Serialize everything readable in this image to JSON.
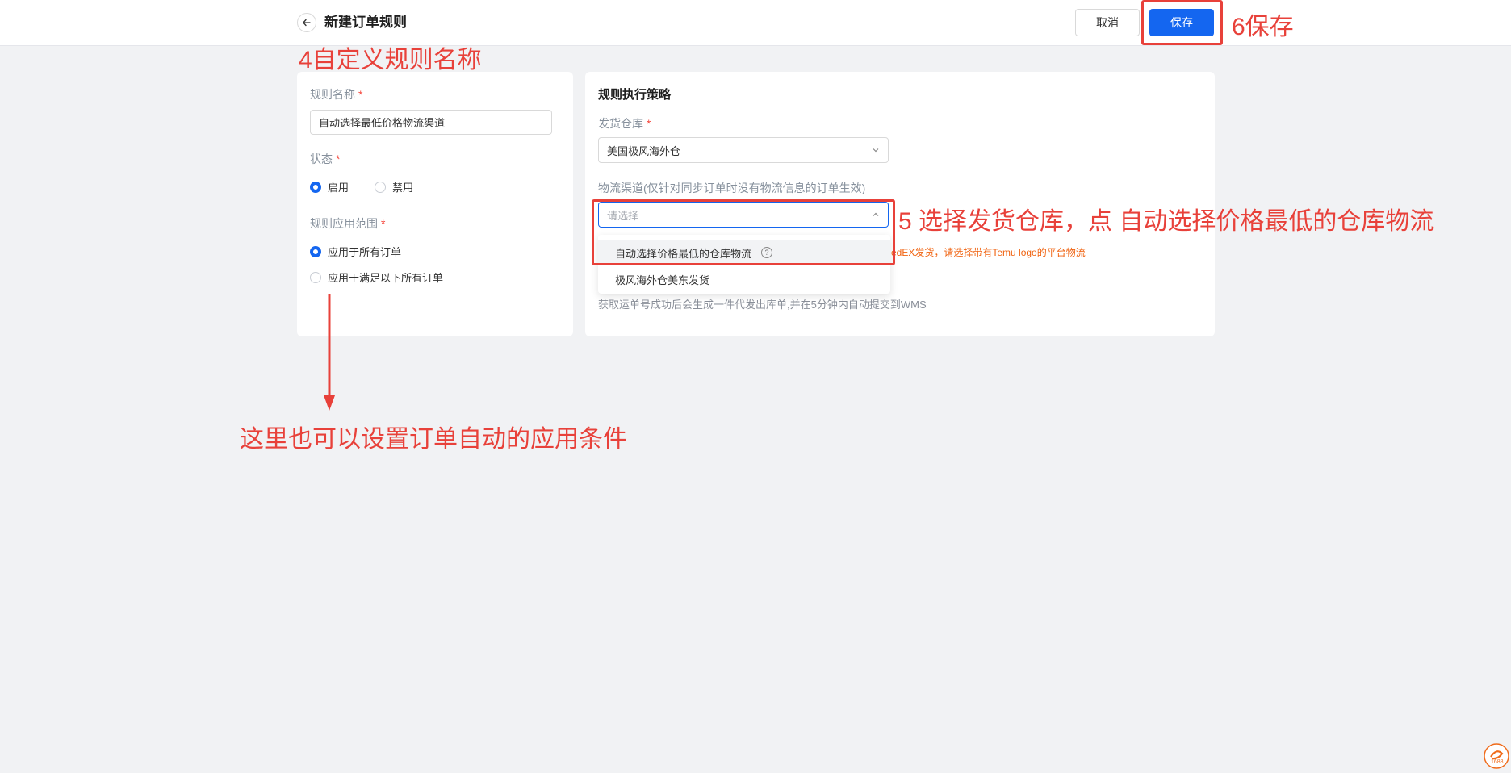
{
  "header": {
    "title": "新建订单规则",
    "cancel_label": "取消",
    "save_label": "保存"
  },
  "left_card": {
    "rule_name_label": "规则名称",
    "rule_name_value": "自动选择最低价格物流渠道",
    "status_label": "状态",
    "status_options": [
      "启用",
      "禁用"
    ],
    "status_selected": "启用",
    "scope_label": "规则应用范围",
    "scope_options": [
      "应用于所有订单",
      "应用于满足以下所有订单"
    ],
    "scope_selected": "应用于所有订单"
  },
  "right_card": {
    "section_title": "规则执行策略",
    "warehouse_label": "发货仓库",
    "warehouse_value": "美国极风海外仓",
    "channel_label": "物流渠道(仅针对同步订单时没有物流信息的订单生效)",
    "channel_placeholder": "请选择",
    "channel_options": [
      "自动选择价格最低的仓库物流",
      "极风海外仓美东发货"
    ],
    "hint_red": "edEX发货，请选择带有Temu logo的平台物流",
    "hint_gray": "获取运单号成功后会生成一件代发出库单,并在5分钟内自动提交到WMS"
  },
  "required_mark": "*",
  "annotations": {
    "step4": "4自定义规则名称",
    "step5": "5 选择发货仓库，点 自动选择价格最低的仓库物流",
    "step6": "6保存",
    "note": "这里也可以设置订单自动的应用条件"
  },
  "watermark": "1688",
  "colors": {
    "primary": "#1466f0",
    "annotation": "#e8413a",
    "background": "#f1f2f4"
  }
}
